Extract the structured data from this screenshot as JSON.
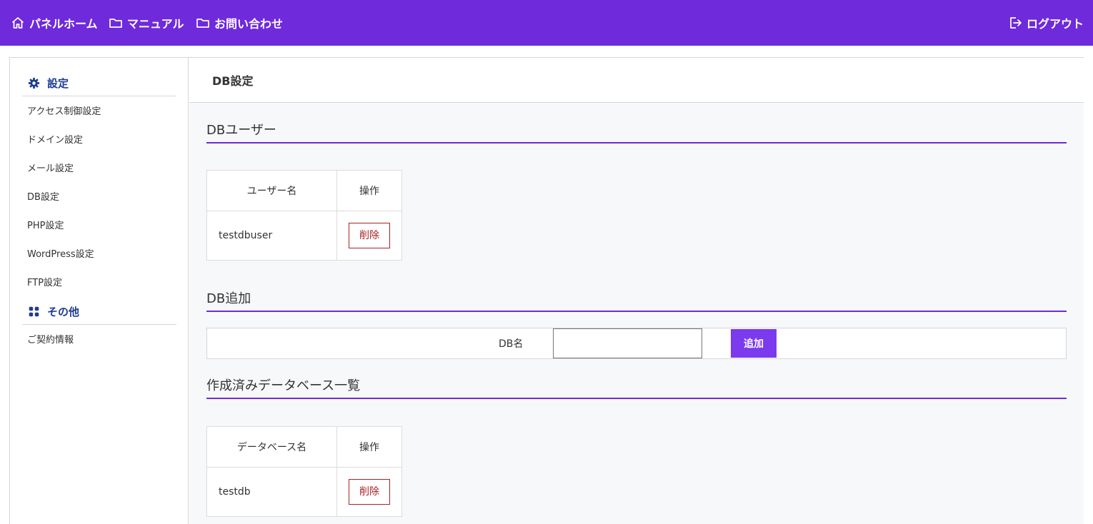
{
  "topnav": {
    "home": "パネルホーム",
    "manual": "マニュアル",
    "contact": "お問い合わせ",
    "logout": "ログアウト"
  },
  "sidebar": {
    "settings_title": "設定",
    "settings_items": [
      "アクセス制御設定",
      "ドメイン設定",
      "メール設定",
      "DB設定",
      "PHP設定",
      "WordPress設定",
      "FTP設定"
    ],
    "other_title": "その他",
    "other_items": [
      "ご契約情報"
    ]
  },
  "main": {
    "page_title": "DB設定",
    "db_users": {
      "section_title": "DBユーザー",
      "columns": [
        "ユーザー名",
        "操作"
      ],
      "rows": [
        {
          "name": "testdbuser",
          "action": "削除"
        }
      ]
    },
    "db_add": {
      "section_title": "DB追加",
      "label": "DB名",
      "input_value": "",
      "button": "追加"
    },
    "db_list": {
      "section_title": "作成済みデータベース一覧",
      "columns": [
        "データベース名",
        "操作"
      ],
      "rows": [
        {
          "name": "testdb",
          "action": "削除"
        }
      ]
    }
  },
  "colors": {
    "topbar": "#6f2adb",
    "accent_button": "#7b3aed",
    "sidebar_heading": "#1d3d91",
    "delete": "#a52323"
  }
}
